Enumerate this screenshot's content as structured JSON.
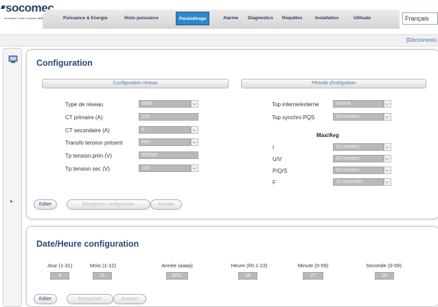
{
  "brand": {
    "name": "socomec",
    "tagline": "Innovative Power Solutions",
    "subbrand": "SCP"
  },
  "nav": {
    "items": [
      {
        "label": "Puissance & Energie"
      },
      {
        "label": "Histo puissance"
      },
      {
        "label": "Paramétrage",
        "active": true
      },
      {
        "label": "Alarme"
      },
      {
        "label": "Diagnostics"
      },
      {
        "label": "Requêtes"
      },
      {
        "label": "Installation"
      },
      {
        "label": "Utilisate"
      }
    ],
    "language": "Français",
    "logout": "[Déconnexio"
  },
  "colors": {
    "active_tab": "#2f87c8",
    "title": "#2a4a78",
    "field_bg": "#b9b9b9"
  },
  "config": {
    "title": "Configuration",
    "section_network": "Configuration réseau",
    "section_integration": "Période d'intégration",
    "network": [
      {
        "label": "Type de réseau",
        "value": "3NBL",
        "dropdown": true
      },
      {
        "label": "CT primaire (A)",
        "value": "125",
        "dropdown": false
      },
      {
        "label": "CT secondaire (A)",
        "value": "5",
        "dropdown": true
      },
      {
        "label": "Transfo tension présent",
        "value": "Non",
        "dropdown": true
      },
      {
        "label": "Tp tension prim (V)",
        "value": "400000",
        "dropdown": false
      },
      {
        "label": "Tp tension sec (V)",
        "value": "100",
        "dropdown": true
      }
    ],
    "integration_top": [
      {
        "label": "Top interne/externe",
        "value": "Interne"
      },
      {
        "label": "Top synchro PQS",
        "value": "10 minutes"
      }
    ],
    "maxavg_title": "Max/Avg",
    "maxavg": [
      {
        "label": "I",
        "value": "15 minutes"
      },
      {
        "label": "U/V",
        "value": "10 minutes"
      },
      {
        "label": "P/Q/S",
        "value": "10 minutes"
      },
      {
        "label": "F",
        "value": "10 secondes"
      }
    ],
    "buttons": {
      "edit": "Editer",
      "save": "Enregistrer configuration",
      "cancel": "Annuler"
    }
  },
  "datetime": {
    "title": "Date/Heure configuration",
    "fields": [
      {
        "label": "Jour (1-31)",
        "value": "9"
      },
      {
        "label": "Mois (1-12)",
        "value": "11"
      },
      {
        "label": "Année (aaaa)",
        "value": "2011"
      },
      {
        "label": "Heure (hh:1-23)",
        "value": "16"
      },
      {
        "label": "Minute (0-59)",
        "value": "27"
      },
      {
        "label": "Seconde (0-59)",
        "value": "28"
      }
    ],
    "buttons": {
      "edit": "Editer",
      "save": "Enregistrer",
      "cancel": "Annuler"
    }
  }
}
